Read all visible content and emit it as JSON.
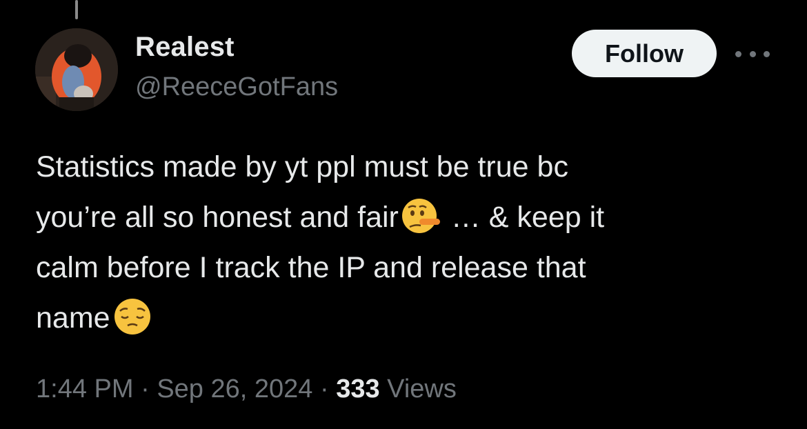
{
  "user": {
    "display_name": "Realest",
    "handle": "@ReeceGotFans"
  },
  "actions": {
    "follow_label": "Follow",
    "more_icon": "more-horizontal-icon"
  },
  "tweet": {
    "line1": "Statistics made by yt ppl must be true bc",
    "line2_before": "you’re all so honest and fair",
    "line2_after": "… & keep it",
    "line3": "calm before I track the IP and release that",
    "line4": "name",
    "emojis": [
      "lying-face-icon",
      "pensive-face-icon"
    ]
  },
  "meta": {
    "time": "1:44 PM",
    "date": "Sep 26, 2024",
    "separator": "·",
    "views_count": "333",
    "views_label": "Views"
  },
  "colors": {
    "background": "#000000",
    "text_primary": "#e7e9ea",
    "text_secondary": "#71767b",
    "follow_bg": "#eff3f4"
  }
}
